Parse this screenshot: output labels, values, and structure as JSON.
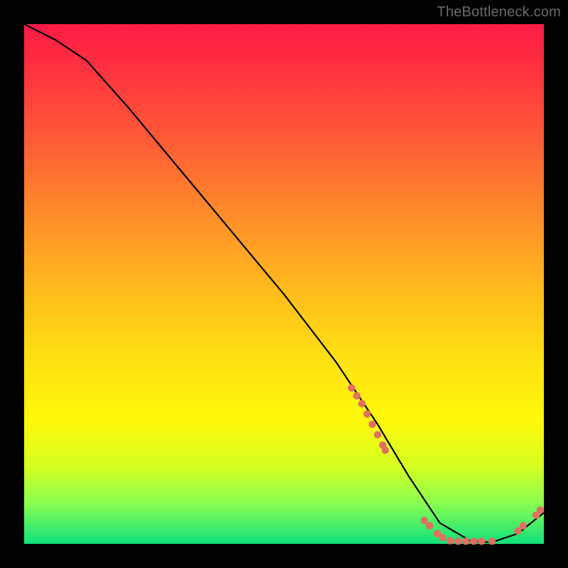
{
  "attribution": "TheBottleneck.com",
  "colors": {
    "curve": "#000000",
    "dot": "#e07060"
  },
  "chart_data": {
    "type": "line",
    "title": "",
    "xlabel": "",
    "ylabel": "",
    "xlim": [
      0,
      100
    ],
    "ylim": [
      0,
      100
    ],
    "grid": false,
    "series": [
      {
        "name": "bottleneck-curve",
        "x": [
          0,
          6,
          12,
          20,
          30,
          40,
          50,
          60,
          68,
          74,
          80,
          86,
          90,
          95,
          100
        ],
        "values": [
          100,
          97,
          93,
          84,
          72,
          60,
          48,
          35,
          23,
          13,
          4,
          0.5,
          0.3,
          2,
          6
        ]
      }
    ],
    "dot_clusters": [
      {
        "name": "descent-cluster",
        "points": [
          [
            63,
            30
          ],
          [
            64,
            28.5
          ],
          [
            65,
            27
          ],
          [
            66,
            25
          ],
          [
            67,
            23
          ],
          [
            68,
            21
          ],
          [
            69,
            19
          ],
          [
            69.5,
            18
          ]
        ]
      },
      {
        "name": "valley-cluster",
        "points": [
          [
            77,
            4.5
          ],
          [
            78,
            3.5
          ],
          [
            79.5,
            2
          ],
          [
            80.5,
            1.2
          ],
          [
            82,
            0.6
          ],
          [
            83.5,
            0.5
          ],
          [
            85,
            0.5
          ],
          [
            86.5,
            0.5
          ],
          [
            88,
            0.5
          ],
          [
            90,
            0.5
          ]
        ]
      },
      {
        "name": "rise-cluster",
        "points": [
          [
            95,
            2.5
          ],
          [
            96,
            3.5
          ],
          [
            98.5,
            5.5
          ],
          [
            99.3,
            6.5
          ]
        ]
      }
    ]
  }
}
